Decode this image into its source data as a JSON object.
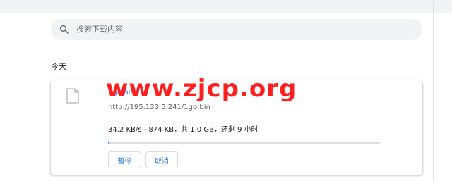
{
  "search": {
    "placeholder": "搜索下载内容",
    "icon": "search-icon"
  },
  "section": {
    "label": "今天"
  },
  "download": {
    "file_name": "1gb.bin",
    "url": "http://195.133.5.241/1gb.bin",
    "status_text": "34.2 KB/s - 874 KB，共 1.0 GB，还剩 9 小时",
    "progress_fraction": 0.0008,
    "file_icon": "file-icon",
    "pause_label": "暂停",
    "cancel_label": "取消"
  },
  "watermark": {
    "text": "www.zjcp.org",
    "color": "#ff1f1f"
  },
  "colors": {
    "accent": "#1a73e8",
    "search_bg": "#f1f3f4"
  }
}
